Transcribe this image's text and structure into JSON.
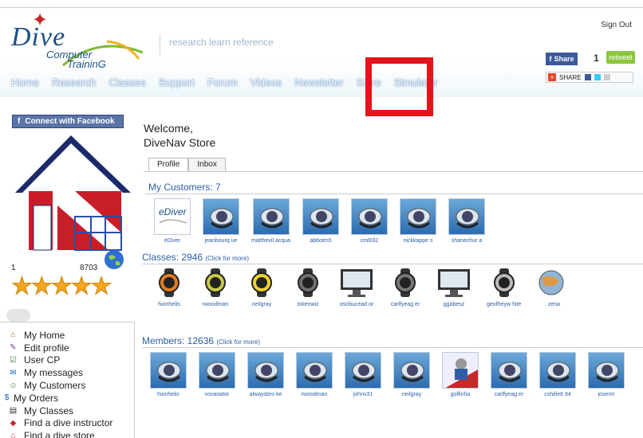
{
  "header": {
    "logo_line1": "Dive",
    "logo_line2": "Computer",
    "logo_line3": "TraininG",
    "tagline": "research   learn   reference",
    "signout": "Sign Out",
    "share_label": "Share",
    "retweet_count": "1",
    "retweet_label": "retweet",
    "addthis_label": "SHARE"
  },
  "nav": [
    "Home",
    "Research",
    "Classes",
    "Support",
    "Forum",
    "Videos",
    "Newsletter",
    "Store",
    "Simulator"
  ],
  "sidebar": {
    "fb_connect": "Connect with Facebook",
    "stat_left": "1",
    "stat_right": "8703",
    "menu": [
      {
        "label": "My Home",
        "icon": "home-icon"
      },
      {
        "label": "Edit profile",
        "icon": "pencil-icon"
      },
      {
        "label": "User CP",
        "icon": "checkbox-icon"
      },
      {
        "label": "My messages",
        "icon": "envelope-icon"
      },
      {
        "label": "My Customers",
        "icon": "customers-icon"
      },
      {
        "label": "My Orders",
        "icon": "dollar-icon"
      },
      {
        "label": "My Classes",
        "icon": "classes-icon"
      },
      {
        "label": "Find a dive instructor",
        "icon": "instructor-icon"
      },
      {
        "label": "Find a dive store",
        "icon": "store-icon"
      }
    ]
  },
  "main": {
    "welcome_line1": "Welcome,",
    "welcome_line2": "DiveNav Store",
    "tabs": [
      "Profile",
      "Inbox"
    ],
    "customers_title": "My Customers: 7",
    "customers": [
      "eDiver",
      "jeanbourq ue",
      "matthevil acqua",
      "abbotm5",
      "cml032",
      "nickkappe s",
      "shanechur a"
    ],
    "classes_title": "Classes: 2946",
    "classes_more": "(Click for more)",
    "classes": [
      "hionhelis",
      "rwoodman",
      "neilgray",
      "tokenwiz",
      "osobucead or",
      "carlfyeag er",
      "ggabesz",
      "geoffreyw hite",
      "zena"
    ],
    "members_title": "Members: 12636",
    "members_more": "(Click for more)",
    "members": [
      "hionhelis",
      "vovanator",
      "alwaysbro ke",
      "rwoodman",
      "johnv31",
      "neilgray",
      "golfinha",
      "carlfyeag er",
      "cshifiett 84",
      "joserm"
    ]
  },
  "colors": {
    "nav_shadow": "#4d84b8",
    "highlight": "#e3141b",
    "link": "#2a5ea8",
    "star": "#f5a623"
  }
}
